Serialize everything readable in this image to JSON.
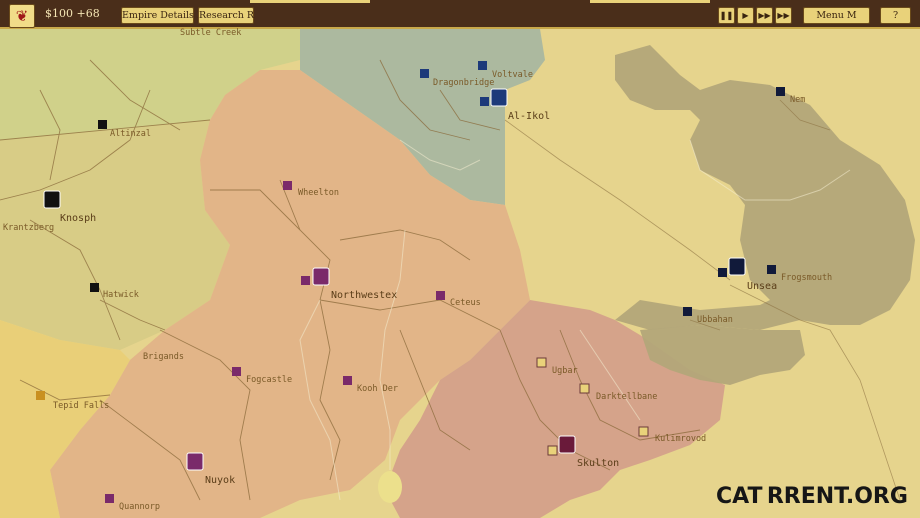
{
  "topbar": {
    "crest_icon": "dragon-crest-icon",
    "money": "$100 +68",
    "empire_details": "Empire Details E",
    "research": "Research R",
    "pause_icon": "pause-icon",
    "play_icon": "play-icon",
    "fast_icon": "fast-forward-icon",
    "faster_icon": "fastest-forward-icon",
    "menu": "Menu M",
    "help": "?"
  },
  "cities": [
    {
      "name": "Subtle Creek"
    },
    {
      "name": "Dragonbridge"
    },
    {
      "name": "Voltvale"
    },
    {
      "name": "Al-Ikol"
    },
    {
      "name": "Altinzal"
    },
    {
      "name": "Knosph"
    },
    {
      "name": "Krantzberg"
    },
    {
      "name": "Wheelton"
    },
    {
      "name": "Northwestex"
    },
    {
      "name": "Hatwick"
    },
    {
      "name": "Ceteus"
    },
    {
      "name": "Brigands"
    },
    {
      "name": "Fogcastle"
    },
    {
      "name": "Kooh Der"
    },
    {
      "name": "Tepid Falls"
    },
    {
      "name": "Nuyok"
    },
    {
      "name": "Quannorp"
    },
    {
      "name": "Ugbar"
    },
    {
      "name": "Darktellbane"
    },
    {
      "name": "Kulimrovod"
    },
    {
      "name": "Skulton"
    },
    {
      "name": "Nem"
    },
    {
      "name": "Unsea"
    },
    {
      "name": "Frogsmouth"
    },
    {
      "name": "Ubbahan"
    }
  ],
  "watermark": "CAT RRENT.ORG",
  "colors": {
    "land": "#e6d48d",
    "orange_empire": "#e2b388",
    "red_empire": "#d4a08a",
    "teal_empire": "#a9b7a0",
    "dark_empire": "#b3a679",
    "green_empire": "#cdd089",
    "topbar": "#4a2e1a"
  }
}
